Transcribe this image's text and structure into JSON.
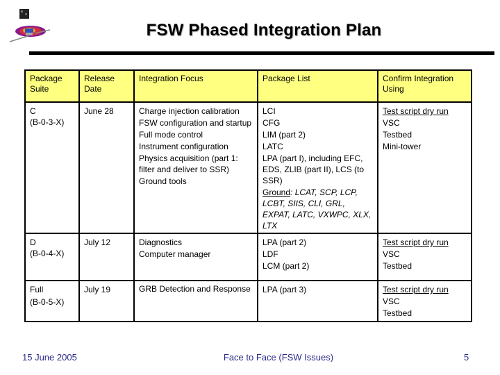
{
  "header": {
    "logo": "glast-satellite-logo",
    "title": "FSW Phased Integration Plan"
  },
  "table": {
    "columns": [
      "Package Suite",
      "Release Date",
      "Integration Focus",
      "Package List",
      "Confirm Integration Using"
    ],
    "header_color": "#ffff80",
    "rows": [
      {
        "suite": [
          "C",
          "(B-0-3-X)"
        ],
        "date": "June 28",
        "focus": [
          "Charge injection calibration",
          "FSW configuration and startup",
          "Full mode control",
          "Instrument configuration",
          "Physics acquisition (part 1: filter and deliver to SSR)",
          "Ground tools"
        ],
        "packages": [
          "LCI",
          "CFG",
          "LIM (part 2)",
          "LATC",
          "LPA (part I), including EFC, EDS, ZLIB (part II), LCS (to SSR)"
        ],
        "ground_label": "Ground",
        "ground_list": ": LCAT, SCP, LCP, LCBT, SIIS, CLI, GRL, EXPAT, LATC, VXWPC, XLX, LTX",
        "confirm": [
          "Test script dry run",
          "VSC",
          "Testbed",
          "Mini-tower"
        ]
      },
      {
        "suite": [
          "D",
          "(B-0-4-X)"
        ],
        "date": "July 12",
        "focus": [
          "Diagnostics",
          "Computer manager"
        ],
        "packages": [
          "LPA (part 2)",
          "LDF",
          "LCM (part 2)"
        ],
        "confirm": [
          "Test script dry run",
          "VSC",
          "Testbed"
        ]
      },
      {
        "suite": [
          "Full",
          "(B-0-5-X)"
        ],
        "date": "July 19",
        "focus": [
          "GRB Detection and Response"
        ],
        "packages": [
          "LPA (part 3)"
        ],
        "confirm": [
          "Test script dry run",
          "VSC",
          "Testbed"
        ]
      }
    ]
  },
  "footer": {
    "date": "15 June 2005",
    "event": "Face to Face (FSW Issues)",
    "page": "5",
    "color": "#2a2a8a"
  }
}
